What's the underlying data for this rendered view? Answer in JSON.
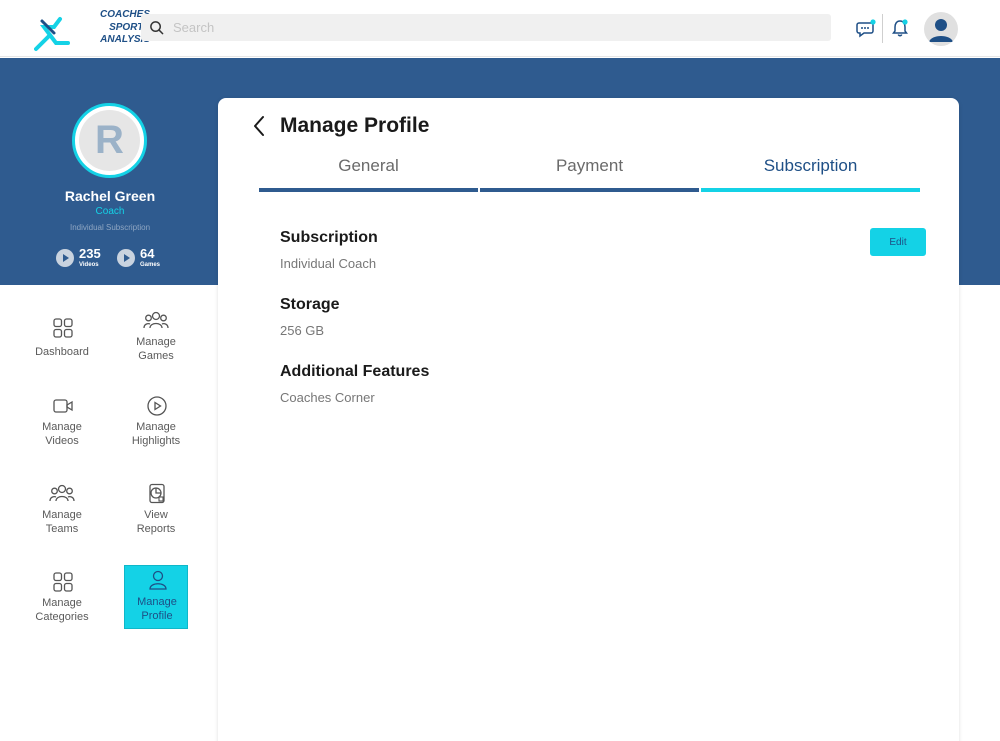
{
  "brand": {
    "line1": "COACHES",
    "line2": "SPORTS",
    "line3": "ANALYSIS"
  },
  "search": {
    "placeholder": "Search",
    "value": ""
  },
  "profile": {
    "initial": "R",
    "name": "Rachel Green",
    "role": "Coach",
    "subscription": "Individual Subscription",
    "stats": [
      {
        "value": "235",
        "label": "Videos"
      },
      {
        "value": "64",
        "label": "Games"
      }
    ]
  },
  "sidebar": {
    "items": [
      {
        "label": "Dashboard",
        "icon": "grid-icon",
        "active": false
      },
      {
        "label": "Manage Games",
        "icon": "group-icon",
        "active": false
      },
      {
        "label": "Manage Videos",
        "icon": "video-camera-icon",
        "active": false
      },
      {
        "label": "Manage Highlights",
        "icon": "play-circle-icon",
        "active": false
      },
      {
        "label": "Manage Teams",
        "icon": "group-icon",
        "active": false
      },
      {
        "label": "View Reports",
        "icon": "report-icon",
        "active": false
      },
      {
        "label": "Manage Categories",
        "icon": "grid-icon",
        "active": false
      },
      {
        "label": "Manage Profile",
        "icon": "user-icon",
        "active": true
      }
    ]
  },
  "main": {
    "title": "Manage Profile",
    "tabs": [
      {
        "label": "General",
        "active": false
      },
      {
        "label": "Payment",
        "active": false
      },
      {
        "label": "Subscription",
        "active": true
      }
    ],
    "edit_label": "Edit",
    "fields": [
      {
        "label": "Subscription",
        "value": "Individual Coach"
      },
      {
        "label": "Storage",
        "value": "256 GB"
      },
      {
        "label": "Additional Features",
        "value": "Coaches Corner"
      }
    ]
  },
  "colors": {
    "primary": "#2f5b8f",
    "accent": "#14d2e6"
  }
}
